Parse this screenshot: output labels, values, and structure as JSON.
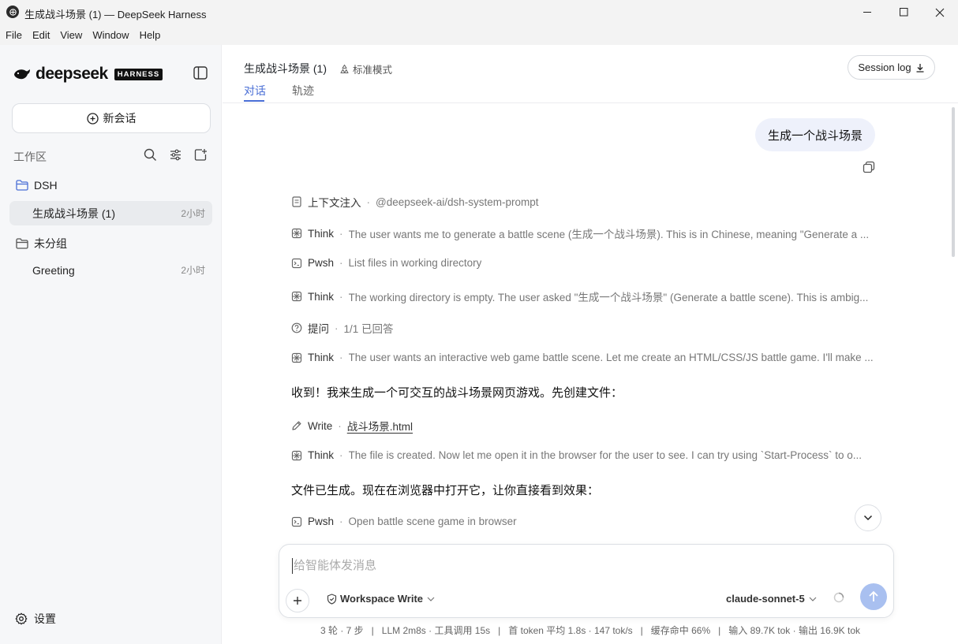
{
  "window": {
    "title": "生成战斗场景 (1) — DeepSeek Harness"
  },
  "menu": [
    "File",
    "Edit",
    "View",
    "Window",
    "Help"
  ],
  "sidebar": {
    "logo_text": "deepseek",
    "logo_badge": "HARNESS",
    "new_chat_label": "新会话",
    "workspace_label": "工作区",
    "groups": [
      {
        "name": "DSH",
        "conversations": [
          {
            "title": "生成战斗场景 (1)",
            "time": "2小时",
            "active": true
          }
        ]
      },
      {
        "name": "未分组",
        "conversations": [
          {
            "title": "Greeting",
            "time": "2小时",
            "active": false
          }
        ]
      }
    ],
    "settings_label": "设置"
  },
  "header": {
    "title": "生成战斗场景 (1)",
    "mode": "标准模式",
    "session_log_label": "Session log",
    "tabs": [
      "对话",
      "轨迹"
    ],
    "active_tab": "对话"
  },
  "conversation": {
    "user_message": "生成一个战斗场景",
    "steps": [
      {
        "icon": "context-icon",
        "kind": "上下文注入",
        "detail": "@deepseek-ai/dsh-system-prompt"
      },
      {
        "icon": "think-icon",
        "kind": "Think",
        "detail": "The user wants me to generate a battle scene (生成一个战斗场景). This is in Chinese, meaning \"Generate a ..."
      },
      {
        "icon": "terminal-icon",
        "kind": "Pwsh",
        "detail": "List files in working directory"
      },
      {
        "icon": "think-icon",
        "kind": "Think",
        "detail": "The working directory is empty. The user asked \"生成一个战斗场景\" (Generate a battle scene). This is ambig..."
      },
      {
        "icon": "question-icon",
        "kind": "提问",
        "detail": "1/1 已回答"
      },
      {
        "icon": "think-icon",
        "kind": "Think",
        "detail": "The user wants an interactive web game battle scene. Let me create an HTML/CSS/JS battle game. I'll make ..."
      }
    ],
    "assistant_text_1": "收到！我来生成一个可交互的战斗场景网页游戏。先创建文件：",
    "write_step": {
      "kind": "Write",
      "file": "战斗场景.html"
    },
    "think_step_2": {
      "kind": "Think",
      "detail": "The file is created. Now let me open it in the browser for the user to see. I can try using `Start-Process` to o..."
    },
    "assistant_text_2": "文件已生成。现在在浏览器中打开它，让你直接看到效果：",
    "pwsh_step_2": {
      "kind": "Pwsh",
      "detail": "Open battle scene game in browser"
    }
  },
  "composer": {
    "placeholder": "给智能体发消息",
    "permission": "Workspace Write",
    "model": "claude-sonnet-5"
  },
  "stats": "3 轮 · 7 步   |   LLM 2m8s · 工具调用 15s   |   首 token 平均 1.8s · 147 tok/s   |   缓存命中 66%   |   输入 89.7K tok · 输出 16.9K tok",
  "colors": {
    "accent": "#4a6fd6",
    "user_bubble": "#eef1fb",
    "send_button": "#a9c0f0"
  }
}
